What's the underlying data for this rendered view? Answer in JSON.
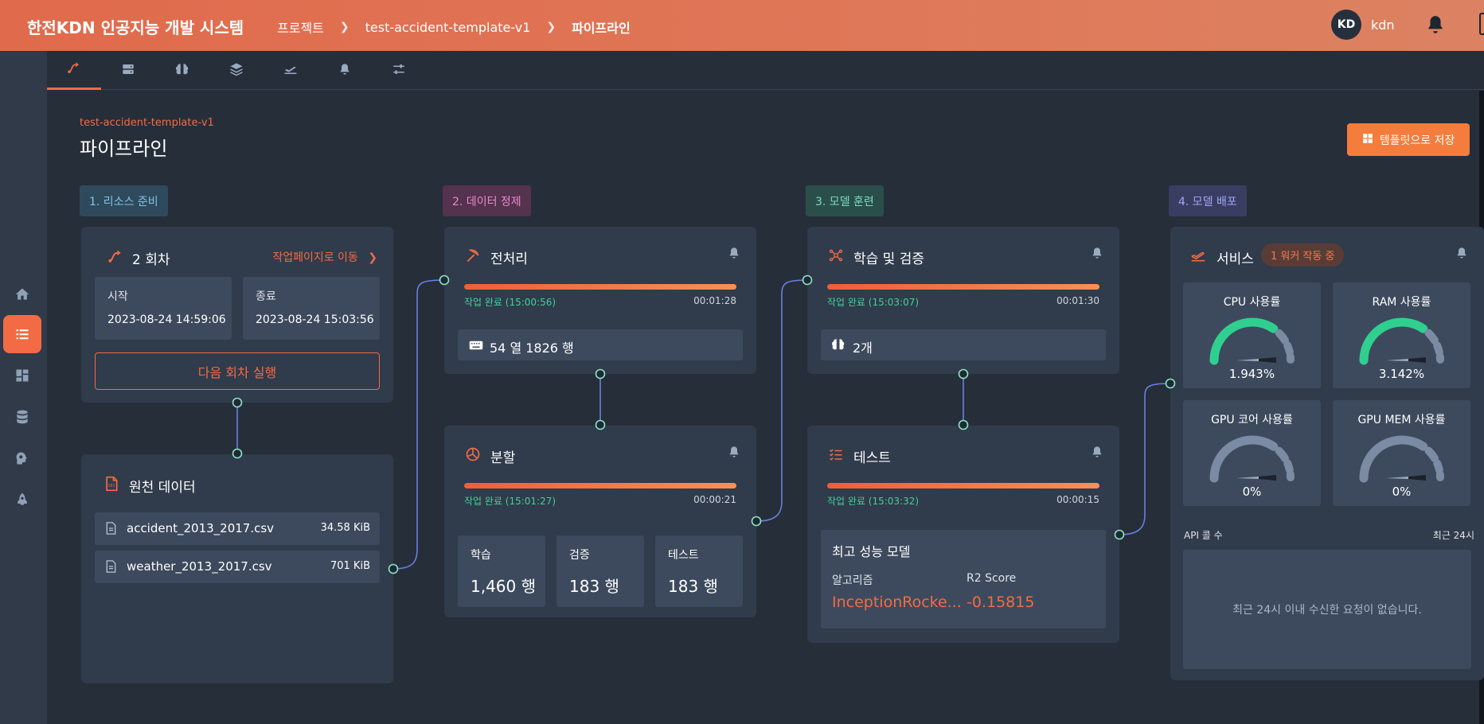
{
  "header": {
    "app_title": "한전KDN 인공지능 개발 시스템",
    "breadcrumb": [
      "프로젝트",
      "test-accident-template-v1",
      "파이프라인"
    ],
    "avatar_initials": "KD",
    "username": "kdn"
  },
  "page": {
    "project_name": "test-accident-template-v1",
    "title": "파이프라인",
    "save_template_label": "템플릿으로 저장"
  },
  "stages": {
    "s1": "1. 리소스 준비",
    "s2": "2. 데이터 정제",
    "s3": "3. 모델 훈련",
    "s4": "4. 모델 배포"
  },
  "run_card": {
    "title": "2 회차",
    "move_link": "작업페이지로 이동",
    "start_label": "시작",
    "start_value": "2023-08-24 14:59:06",
    "end_label": "종료",
    "end_value": "2023-08-24 15:03:56",
    "next_run_label": "다음 회차 실행"
  },
  "source_card": {
    "title": "원천 데이터",
    "files": [
      {
        "name": "accident_2013_2017.csv",
        "size": "34.58 KiB"
      },
      {
        "name": "weather_2013_2017.csv",
        "size": "701 KiB"
      }
    ]
  },
  "preprocess_card": {
    "title": "전처리",
    "progress": 1.0,
    "status": "작업 완료 (15:00:56)",
    "elapsed": "00:01:28",
    "summary": "54 열 1826 행"
  },
  "split_card": {
    "title": "분할",
    "progress": 1.0,
    "status": "작업 완료 (15:01:27)",
    "elapsed": "00:00:21",
    "parts": [
      {
        "label": "학습",
        "value": "1,460 행"
      },
      {
        "label": "검증",
        "value": "183 행"
      },
      {
        "label": "테스트",
        "value": "183 행"
      }
    ]
  },
  "train_card": {
    "title": "학습 및 검증",
    "progress": 1.0,
    "status": "작업 완료 (15:03:07)",
    "elapsed": "00:01:30",
    "model_count": "2개"
  },
  "test_card": {
    "title": "테스트",
    "progress": 1.0,
    "status": "작업 완료 (15:03:32)",
    "elapsed": "00:00:15",
    "best_title": "최고 성능 모델",
    "algo_label": "알고리즘",
    "algo_value": "InceptionRocke...",
    "score_label": "R2 Score",
    "score_value": "-0.15815"
  },
  "service_card": {
    "title": "서비스",
    "worker_badge": "1 워커 작동 중",
    "gauges": [
      {
        "label": "CPU 사용률",
        "value": "1.943%",
        "level": 0.01943,
        "active": true
      },
      {
        "label": "RAM 사용률",
        "value": "3.142%",
        "level": 0.03142,
        "active": true
      },
      {
        "label": "GPU 코어 사용률",
        "value": "0%",
        "level": 0,
        "active": false
      },
      {
        "label": "GPU MEM 사용률",
        "value": "0%",
        "level": 0,
        "active": false
      }
    ],
    "api_label": "API 콜 수",
    "api_range": "최근 24시",
    "api_empty": "최근 24시 이내 수신한 요청이 없습니다."
  },
  "colors": {
    "accent": "#f36b45",
    "success": "#3fd29a",
    "gauge_active": "#2fd08f",
    "gauge_idle": "#7a8ba3",
    "connector": "#6a7fe0"
  },
  "icons": {
    "sidebar": [
      "home-icon",
      "list-icon",
      "dashboard-icon",
      "database-icon",
      "brain-gear-icon",
      "rocket-icon"
    ],
    "tabs": [
      "pipeline-icon",
      "server-icon",
      "brain-icon",
      "layers-icon",
      "plane-icon",
      "bell-icon",
      "sliders-icon"
    ]
  }
}
